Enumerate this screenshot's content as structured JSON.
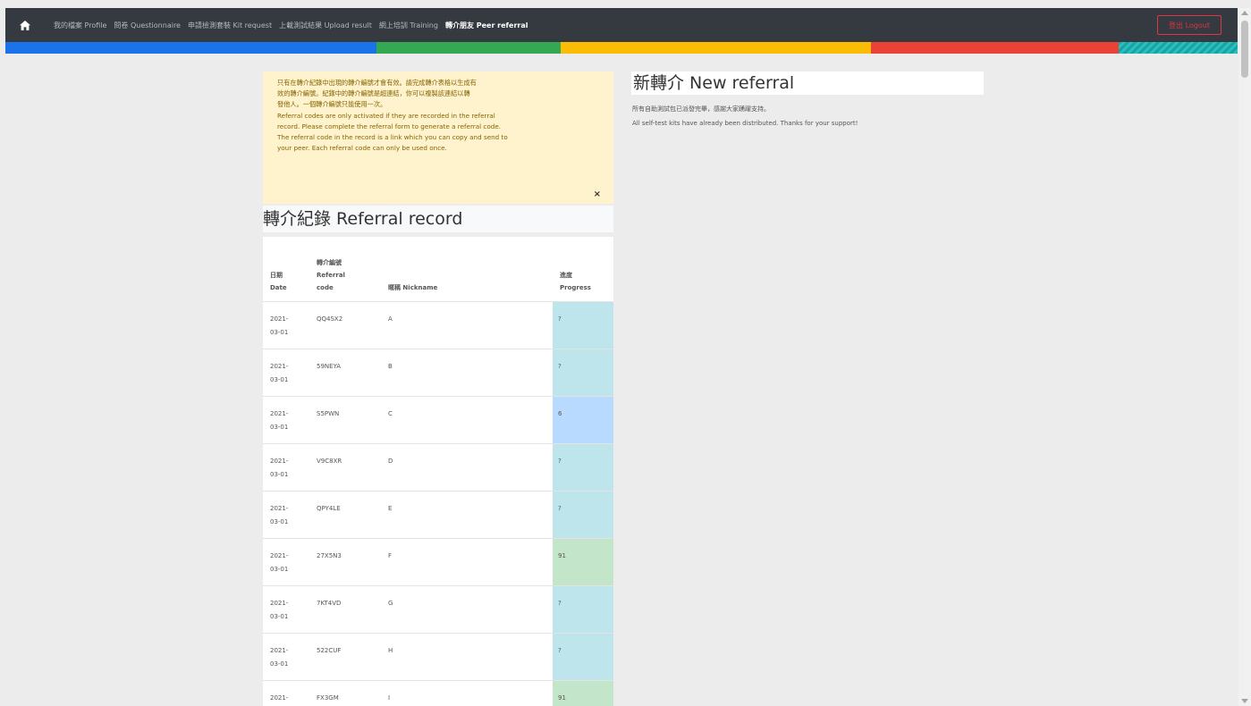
{
  "nav": {
    "items": [
      "我的檔案 Profile",
      "問卷 Questionnaire",
      "申請檢測套裝 Kit request",
      "上載測試結果 Upload result",
      "網上培訓 Training",
      "轉介朋友 Peer referral"
    ],
    "active_index": 5,
    "logout_label": "登出 Logout"
  },
  "stripe_colors": [
    "#1a73e8",
    "#34a853",
    "#fbbc05",
    "#ea4335",
    "#1aa3a3"
  ],
  "alert": {
    "lines": [
      "只有在轉介紀錄中出現的轉介編號才會有效。請完成轉介表格以生成有",
      "效的轉介編號。紀錄中的轉介編號是超連結，你可以複製該連結以轉",
      "發他人。一個轉介編號只能使用一次。",
      "Referral codes are only activated if they are recorded in the referral",
      "record. Please complete the referral form to generate a referral code.",
      "The referral code in the record is a link which you can copy and send to",
      "your peer. Each referral code can only be used once."
    ],
    "close_label": "×"
  },
  "record": {
    "title": "轉介紀錄 Referral record",
    "headers": {
      "date": [
        "日期",
        "Date"
      ],
      "code": [
        "轉介編號",
        "Referral",
        "code"
      ],
      "nickname": "暱稱 Nickname",
      "progress": [
        "進度",
        "Progress"
      ]
    },
    "rows": [
      {
        "date": [
          "2021-",
          "03-01"
        ],
        "code": "QQ4SX2",
        "nickname": "A",
        "progress": "?",
        "status": "info"
      },
      {
        "date": [
          "2021-",
          "03-01"
        ],
        "code": "59NEYA",
        "nickname": "B",
        "progress": "?",
        "status": "info"
      },
      {
        "date": [
          "2021-",
          "03-01"
        ],
        "code": "S5PWN",
        "nickname": "C",
        "progress": "6",
        "status": "primary"
      },
      {
        "date": [
          "2021-",
          "03-01"
        ],
        "code": "V9C8XR",
        "nickname": "D",
        "progress": "?",
        "status": "info"
      },
      {
        "date": [
          "2021-",
          "03-01"
        ],
        "code": "QPY4LE",
        "nickname": "E",
        "progress": "?",
        "status": "info"
      },
      {
        "date": [
          "2021-",
          "03-01"
        ],
        "code": "27X5N3",
        "nickname": "F",
        "progress": "91",
        "status": "success"
      },
      {
        "date": [
          "2021-",
          "03-01"
        ],
        "code": "7KT4VD",
        "nickname": "G",
        "progress": "?",
        "status": "info"
      },
      {
        "date": [
          "2021-",
          "03-01"
        ],
        "code": "522CUF",
        "nickname": "H",
        "progress": "?",
        "status": "info"
      },
      {
        "date": [
          "2021-",
          ""
        ],
        "code": "FX3GM",
        "nickname": "I",
        "progress": "91",
        "status": "success"
      }
    ]
  },
  "new_referral": {
    "title": "新轉介 New referral",
    "line_zh": "所有自助測試包已派發完畢，感謝大家踴躍支持。",
    "line_en": "All self-test kits have already been distributed. Thanks for your support!"
  }
}
